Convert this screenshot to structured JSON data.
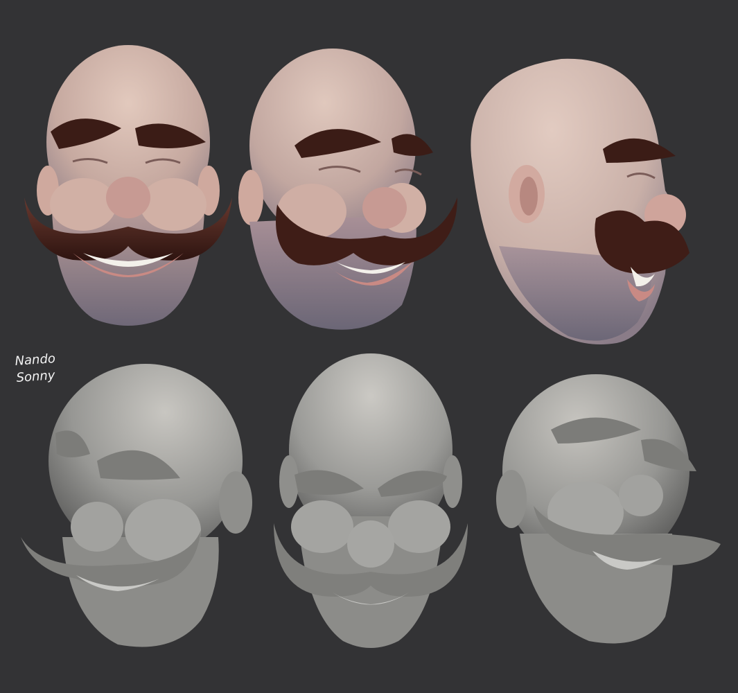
{
  "background_color": "#333335",
  "signature": {
    "line1": "Nando",
    "line2": "Sonny",
    "color": "#f4f4f4"
  },
  "colors": {
    "painted_skin": "#d8bdb1",
    "painted_skin_shadow": "#8a7a80",
    "stubble": "#7d7480",
    "mustache_brown": "#3f1d17",
    "mustache_highlight": "#6a3a30",
    "teeth": "#f3f0ea",
    "lip": "#c98a84",
    "clay_light": "#c2c0bb",
    "clay_mid": "#8c8c89",
    "clay_dark": "#4e4e4d"
  },
  "rows": [
    {
      "name": "painted-row",
      "heads": [
        {
          "view": "front",
          "material": "painted"
        },
        {
          "view": "three-quarter-right",
          "material": "painted"
        },
        {
          "view": "profile-right",
          "material": "painted"
        }
      ]
    },
    {
      "name": "clay-row",
      "heads": [
        {
          "view": "three-quarter-left",
          "material": "clay"
        },
        {
          "view": "front-low",
          "material": "clay"
        },
        {
          "view": "three-quarter-right-low",
          "material": "clay"
        }
      ]
    }
  ]
}
